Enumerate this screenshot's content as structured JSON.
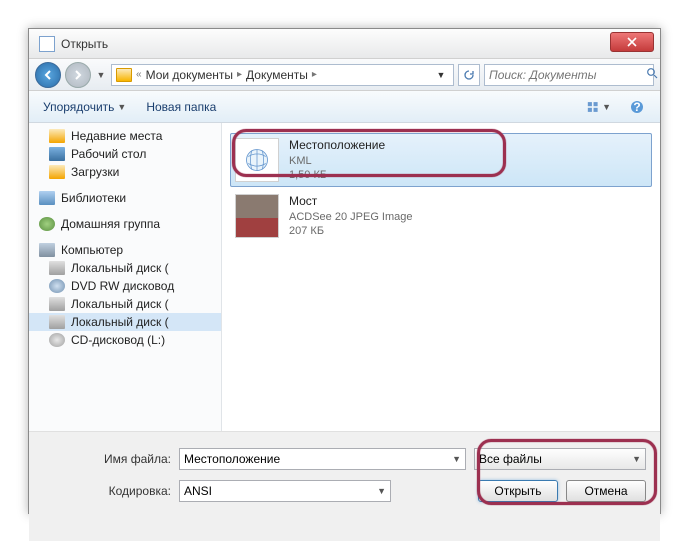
{
  "window": {
    "title": "Открыть"
  },
  "nav": {
    "breadcrumb": [
      "Мои документы",
      "Документы"
    ],
    "search_placeholder": "Поиск: Документы"
  },
  "toolbar": {
    "organize": "Упорядочить",
    "newfolder": "Новая папка"
  },
  "tree": {
    "recent": "Недавние места",
    "desktop": "Рабочий стол",
    "downloads": "Загрузки",
    "libraries": "Библиотеки",
    "homegroup": "Домашняя группа",
    "computer": "Компьютер",
    "disks": [
      "Локальный диск (",
      "DVD RW дисковод",
      "Локальный диск (",
      "Локальный диск (",
      "CD-дисковод (L:)"
    ]
  },
  "files": [
    {
      "name": "Местоположение",
      "type": "KML",
      "size": "1,50 КБ"
    },
    {
      "name": "Мост",
      "type": "ACDSee 20 JPEG Image",
      "size": "207 КБ"
    }
  ],
  "footer": {
    "filename_label": "Имя файла:",
    "filename_value": "Местоположение",
    "encoding_label": "Кодировка:",
    "encoding_value": "ANSI",
    "filter": "Все файлы",
    "open": "Открыть",
    "cancel": "Отмена"
  }
}
